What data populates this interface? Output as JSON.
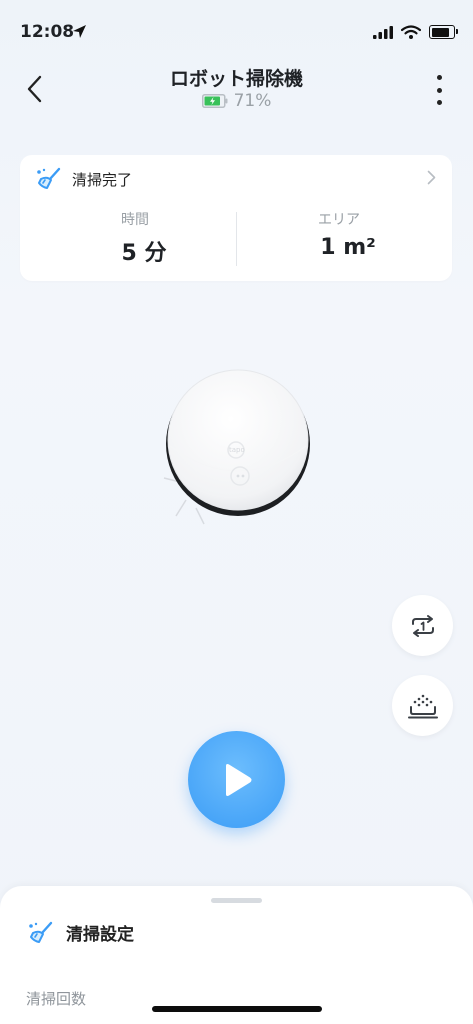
{
  "statusbar": {
    "time": "12:08"
  },
  "header": {
    "title": "ロボット掃除機",
    "battery_percent": "71%"
  },
  "status_card": {
    "status": "清掃完了",
    "time_label": "時間",
    "time_value": "5 分",
    "area_label": "エリア",
    "area_value": "1 m²"
  },
  "robot": {
    "brand": "tapo"
  },
  "sheet": {
    "title": "清掃設定",
    "subtitle": "清掃回数"
  },
  "colors": {
    "accent": "#3b9cf6",
    "battery_green": "#39c15a",
    "background": "#eef3f9"
  },
  "icons": {
    "back": "chevron-left-icon",
    "more": "more-vertical-icon",
    "status": "broom-icon",
    "repeat": "repeat-once-icon",
    "suction": "dust-suction-icon",
    "play": "play-icon"
  }
}
